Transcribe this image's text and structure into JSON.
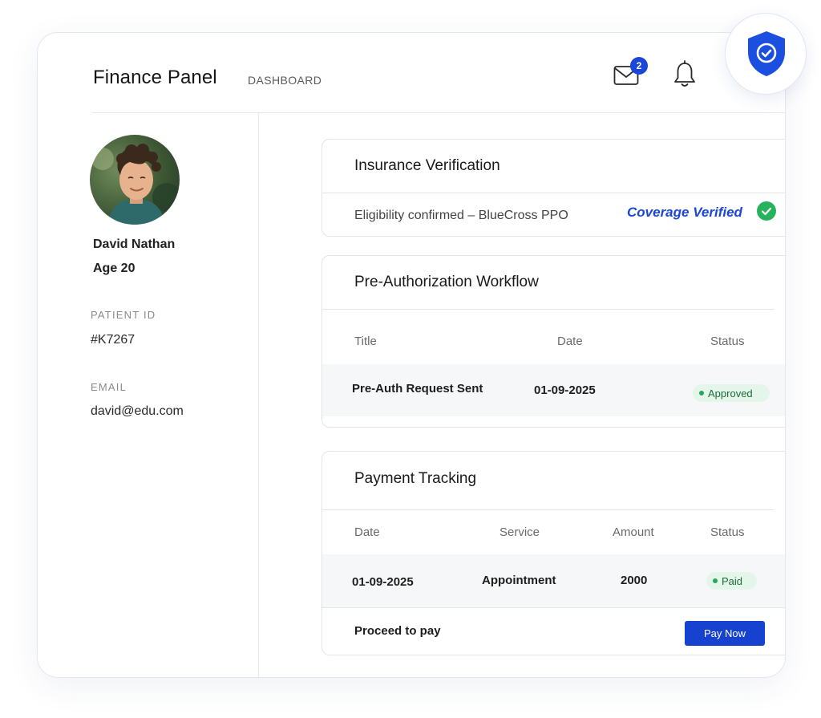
{
  "header": {
    "title": "Finance Panel",
    "subtitle": "DASHBOARD",
    "mail_badge": "2"
  },
  "icons": {
    "mail": "mail-icon",
    "bell": "bell-icon",
    "shield": "shield-check-icon",
    "verified": "check-circle-icon"
  },
  "colors": {
    "accent": "#1742cf",
    "verified_text": "#1a47d6",
    "success": "#27b35c",
    "pill_bg": "#e4f6ea"
  },
  "patient": {
    "name": "David Nathan",
    "age": "Age 20",
    "id_label": "PATIENT ID",
    "id": "#K7267",
    "email_label": "EMAIL",
    "email": "david@edu.com"
  },
  "insurance": {
    "title": "Insurance Verification",
    "detail": "Eligibility confirmed – BlueCross PPO",
    "status": "Coverage Verified"
  },
  "preauth": {
    "title": "Pre-Authorization Workflow",
    "headers": {
      "title": "Title",
      "date": "Date",
      "status": "Status"
    },
    "row": {
      "title": "Pre-Auth Request Sent",
      "date": "01-09-2025",
      "status": "Approved"
    }
  },
  "payment": {
    "title": "Payment Tracking",
    "headers": {
      "date": "Date",
      "service": "Service",
      "amount": "Amount",
      "status": "Status"
    },
    "row": {
      "date": "01-09-2025",
      "service": "Appointment",
      "amount": "2000",
      "status": "Paid"
    },
    "proceed_label": "Proceed to pay",
    "pay_button": "Pay Now"
  }
}
